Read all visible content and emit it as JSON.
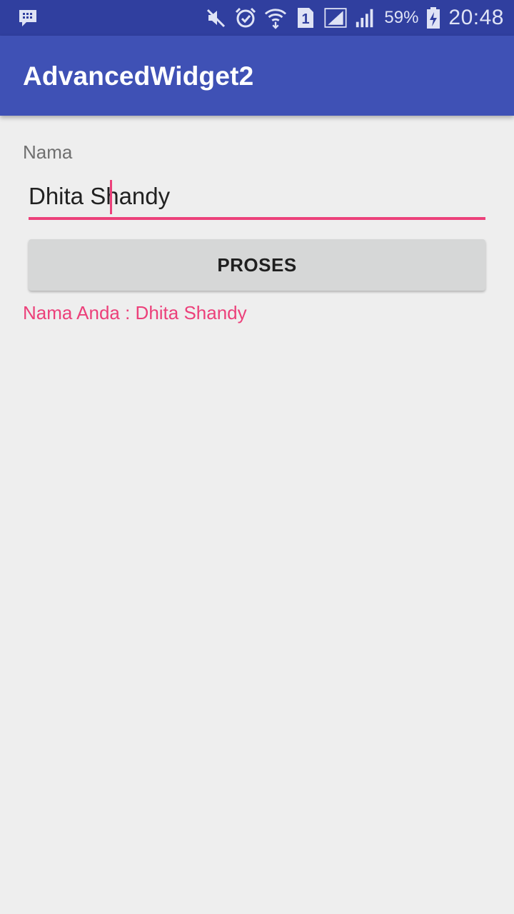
{
  "status_bar": {
    "notification_icon": "bbm-chat-icon",
    "icons": [
      "mute-icon",
      "alarm-icon",
      "wifi-icon",
      "sim1-icon",
      "signal-sim1-icon",
      "signal-sim2-icon"
    ],
    "sim_label": "1",
    "battery_percent": "59%",
    "battery_icon": "battery-charging-icon",
    "time": "20:48"
  },
  "app_bar": {
    "title": "AdvancedWidget2"
  },
  "form": {
    "name_label": "Nama",
    "name_value": "Dhita Shandy",
    "button_label": "PROSES",
    "result_text": "Nama Anda : Dhita Shandy"
  },
  "colors": {
    "status_bar": "#303f9f",
    "primary": "#3f51b5",
    "accent": "#ec407a",
    "background": "#eeeeee",
    "button": "#d6d7d7"
  }
}
